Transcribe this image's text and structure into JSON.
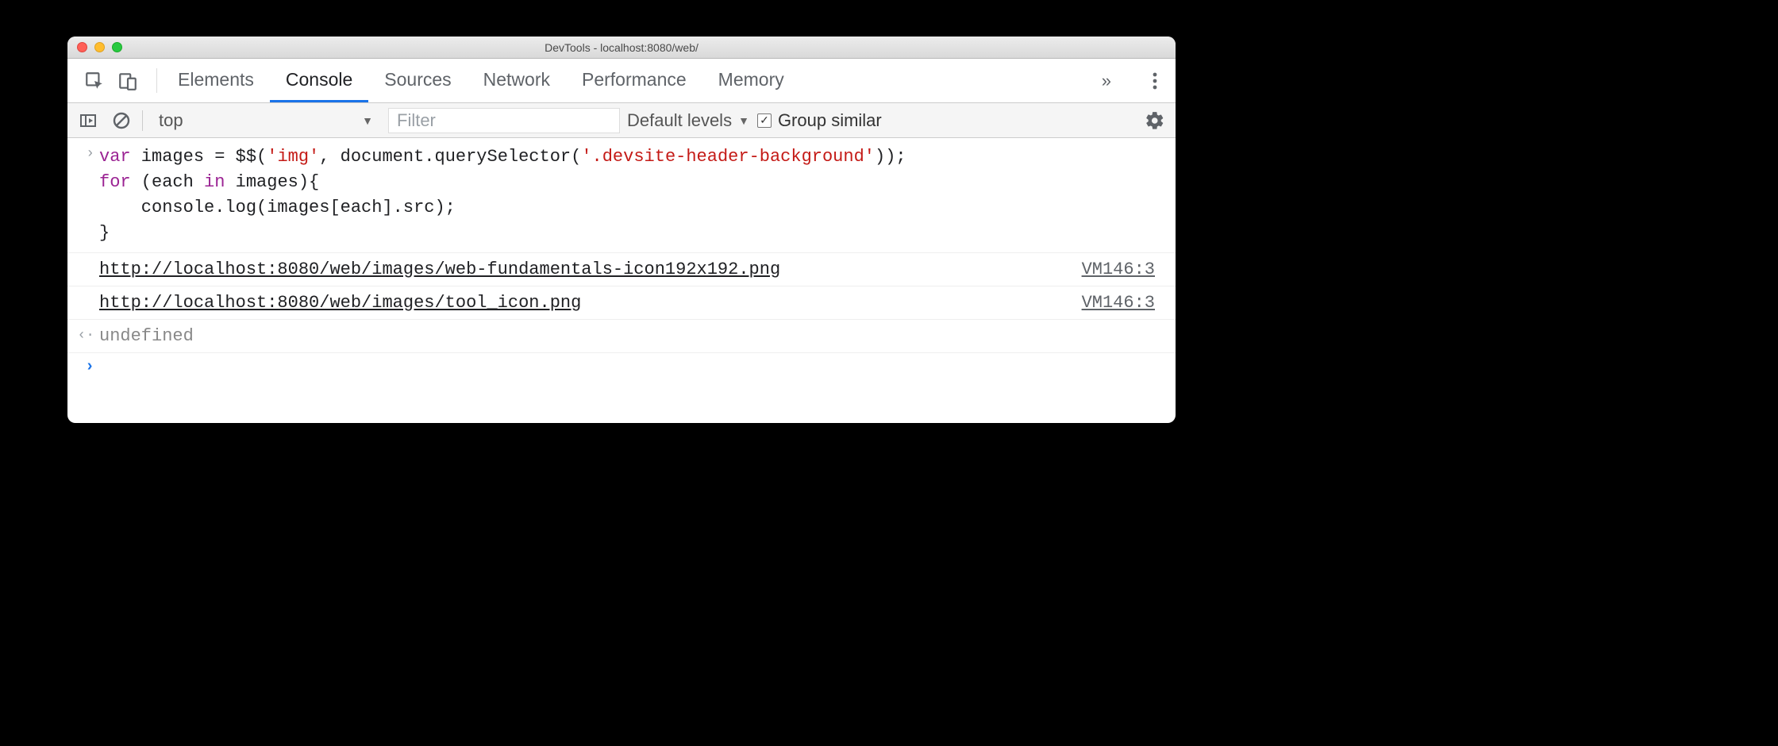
{
  "window": {
    "title": "DevTools - localhost:8080/web/"
  },
  "tabs": {
    "items": [
      "Elements",
      "Console",
      "Sources",
      "Network",
      "Performance",
      "Memory"
    ],
    "active_index": 1,
    "overflow_glyph": "»"
  },
  "console_toolbar": {
    "context": "top",
    "filter_placeholder": "Filter",
    "levels_label": "Default levels",
    "group_similar_label": "Group similar",
    "group_similar_checked": true
  },
  "console": {
    "input_code": {
      "line1_pre": "var",
      "line1_mid1": " images = $$(",
      "line1_str1": "'img'",
      "line1_mid2": ", document.querySelector(",
      "line1_str2": "'.devsite-header-background'",
      "line1_post": "));",
      "line2_pre": "for",
      "line2_mid1": " (each ",
      "line2_in": "in",
      "line2_mid2": " images){",
      "line3": "    console.log(images[each].src);",
      "line4": "}"
    },
    "outputs": [
      {
        "text": "http://localhost:8080/web/images/web-fundamentals-icon192x192.png",
        "source": "VM146:3"
      },
      {
        "text": "http://localhost:8080/web/images/tool_icon.png",
        "source": "VM146:3"
      }
    ],
    "return_value": "undefined",
    "prompt_value": ""
  },
  "glyphs": {
    "chevron_right": "›",
    "chevron_left": "‹",
    "dropdown": "▼",
    "check": "✓",
    "input_prompt": "›",
    "output_prompt": "‹·"
  }
}
